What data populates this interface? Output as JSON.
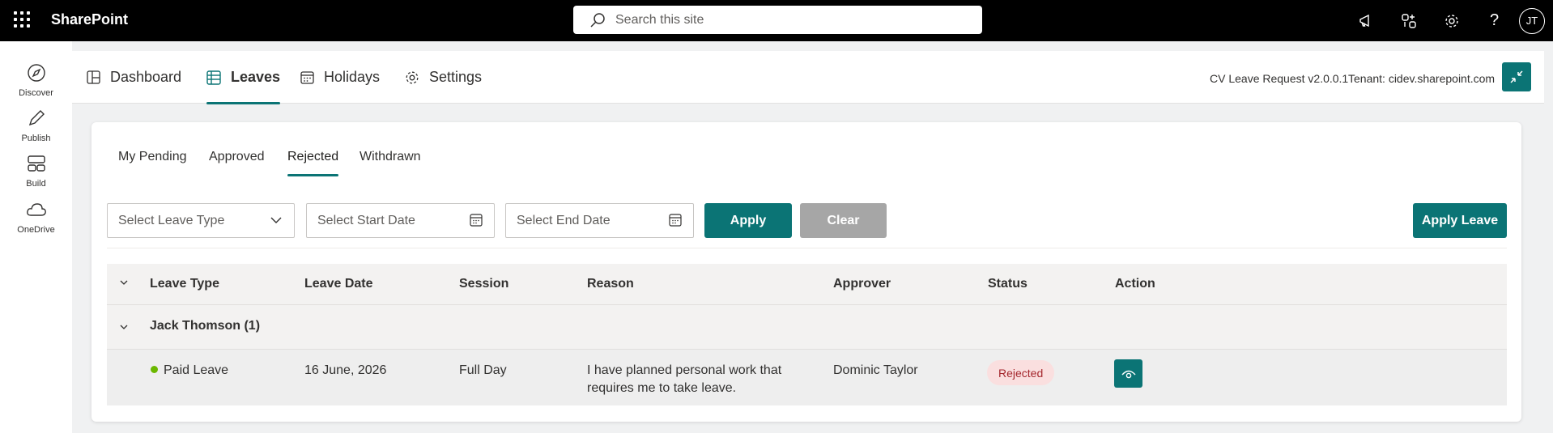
{
  "suite": {
    "app_name": "SharePoint",
    "search_placeholder": "Search this site",
    "avatar_initials": "JT"
  },
  "appbar": {
    "items": [
      {
        "label": "Discover",
        "icon": "compass-icon"
      },
      {
        "label": "Publish",
        "icon": "pen-icon"
      },
      {
        "label": "Build",
        "icon": "layout-icon"
      },
      {
        "label": "OneDrive",
        "icon": "cloud-icon"
      }
    ]
  },
  "header": {
    "tabs": [
      {
        "label": "Dashboard",
        "icon": "dashboard-icon"
      },
      {
        "label": "Leaves",
        "icon": "table-icon",
        "active": true
      },
      {
        "label": "Holidays",
        "icon": "calendar-icon"
      },
      {
        "label": "Settings",
        "icon": "gear-icon"
      }
    ],
    "version": "CV Leave Request v2.0.0.1",
    "tenant": "Tenant: cidev.sharepoint.com"
  },
  "subtabs": [
    {
      "label": "My Pending"
    },
    {
      "label": "Approved"
    },
    {
      "label": "Rejected",
      "active": true
    },
    {
      "label": "Withdrawn"
    }
  ],
  "filters": {
    "leave_type_placeholder": "Select Leave Type",
    "start_date_placeholder": "Select Start Date",
    "end_date_placeholder": "Select End Date",
    "apply_label": "Apply",
    "clear_label": "Clear",
    "apply_leave_label": "Apply Leave"
  },
  "table": {
    "columns": [
      "Leave Type",
      "Leave Date",
      "Session",
      "Reason",
      "Approver",
      "Status",
      "Action"
    ],
    "group": {
      "label": "Jack Thomson (1)"
    },
    "rows": [
      {
        "leave_type": "Paid Leave",
        "leave_date": "16 June, 2026",
        "session": "Full Day",
        "reason_line1": "I have planned personal work that",
        "reason_line2": "requires me to take leave.",
        "approver": "Dominic Taylor",
        "status": "Rejected"
      }
    ]
  },
  "colors": {
    "accent": "#0b7475",
    "rejected_bg": "#fadfdf",
    "rejected_text": "#a4262c",
    "leave_dot": "#6bb700"
  }
}
